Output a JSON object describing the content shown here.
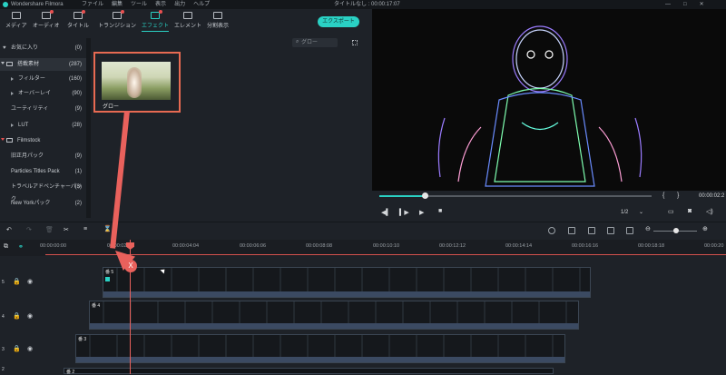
{
  "titlebar": {
    "app": "Wondershare Filmora",
    "menu": [
      "ファイル",
      "編集",
      "ツール",
      "表示",
      "出力",
      "ヘルプ"
    ],
    "title": "タイトルなし : 00:00:17:07"
  },
  "toolbar": {
    "tabs": [
      {
        "label": "メディア",
        "icon": "folder-icon"
      },
      {
        "label": "オーディオ",
        "icon": "music-icon"
      },
      {
        "label": "タイトル",
        "icon": "text-icon"
      },
      {
        "label": "トランジション",
        "icon": "transition-icon"
      },
      {
        "label": "エフェクト",
        "icon": "effects-icon"
      },
      {
        "label": "エレメント",
        "icon": "element-icon"
      },
      {
        "label": "分割表示",
        "icon": "split-icon"
      }
    ],
    "active": "エフェクト",
    "export": "エクスポート"
  },
  "sidebar": {
    "items": [
      {
        "label": "お気に入り",
        "count": "(0)"
      },
      {
        "label": "搭載素材",
        "count": "(287)"
      },
      {
        "label": "フィルター",
        "count": "(160)"
      },
      {
        "label": "オーバーレイ",
        "count": "(90)"
      },
      {
        "label": "ユーティリティ",
        "count": "(9)"
      },
      {
        "label": "LUT",
        "count": "(28)"
      },
      {
        "label": "Filmstock",
        "count": ""
      },
      {
        "label": "旧正月パック",
        "count": "(9)"
      },
      {
        "label": "Particles Titles Pack",
        "count": "(1)"
      },
      {
        "label": "トラベルアドベンチャーパック",
        "count": "(3)"
      },
      {
        "label": "New Yorkパック",
        "count": "(2)"
      }
    ]
  },
  "search": {
    "placeholder": "グロー"
  },
  "thumb": {
    "label": "グロー"
  },
  "player": {
    "time": "00:00:02:2",
    "ratio": "1/2"
  },
  "ruler": {
    "ticks": [
      "00:00:00:00",
      "00:00:02:02",
      "00:00:04:04",
      "00:00:06:06",
      "00:00:08:08",
      "00:00:10:10",
      "00:00:12:12",
      "00:00:14:14",
      "00:00:16:16",
      "00:00:18:18",
      "00:00:20"
    ]
  },
  "tracks": [
    {
      "id": "5",
      "clip_label": "番 5"
    },
    {
      "id": "4",
      "clip_label": "番 4"
    },
    {
      "id": "3",
      "clip_label": "番 3"
    },
    {
      "id": "2",
      "clip_label": "番 2"
    }
  ],
  "drag_marker": "X",
  "colors": {
    "accent": "#2ad1c4",
    "annotation": "#e9615c",
    "clip_bar": "#3b4a62"
  }
}
